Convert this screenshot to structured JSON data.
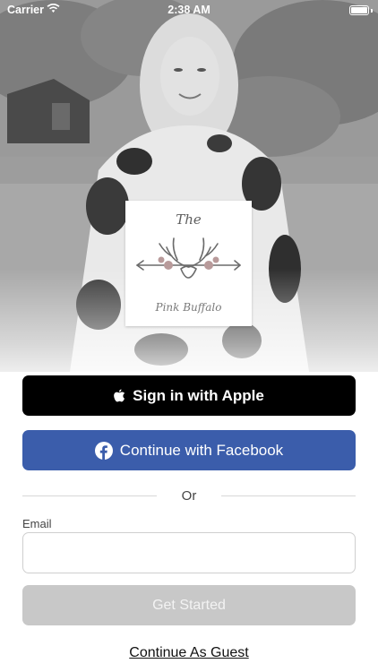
{
  "status_bar": {
    "carrier": "Carrier",
    "time": "2:38 AM",
    "wifi_icon": "wifi-icon",
    "battery_icon": "battery-icon"
  },
  "hero": {
    "logo": {
      "line1": "The",
      "line2": "Pink Buffalo"
    }
  },
  "auth": {
    "apple_label": "Sign in with Apple",
    "facebook_label": "Continue with Facebook",
    "divider_text": "Or",
    "email_label": "Email",
    "email_value": "",
    "email_placeholder": "",
    "get_started_label": "Get Started",
    "guest_label": "Continue As Guest"
  },
  "colors": {
    "apple_bg": "#000000",
    "facebook_bg": "#3b5dab",
    "disabled_bg": "#c8c8c8"
  }
}
